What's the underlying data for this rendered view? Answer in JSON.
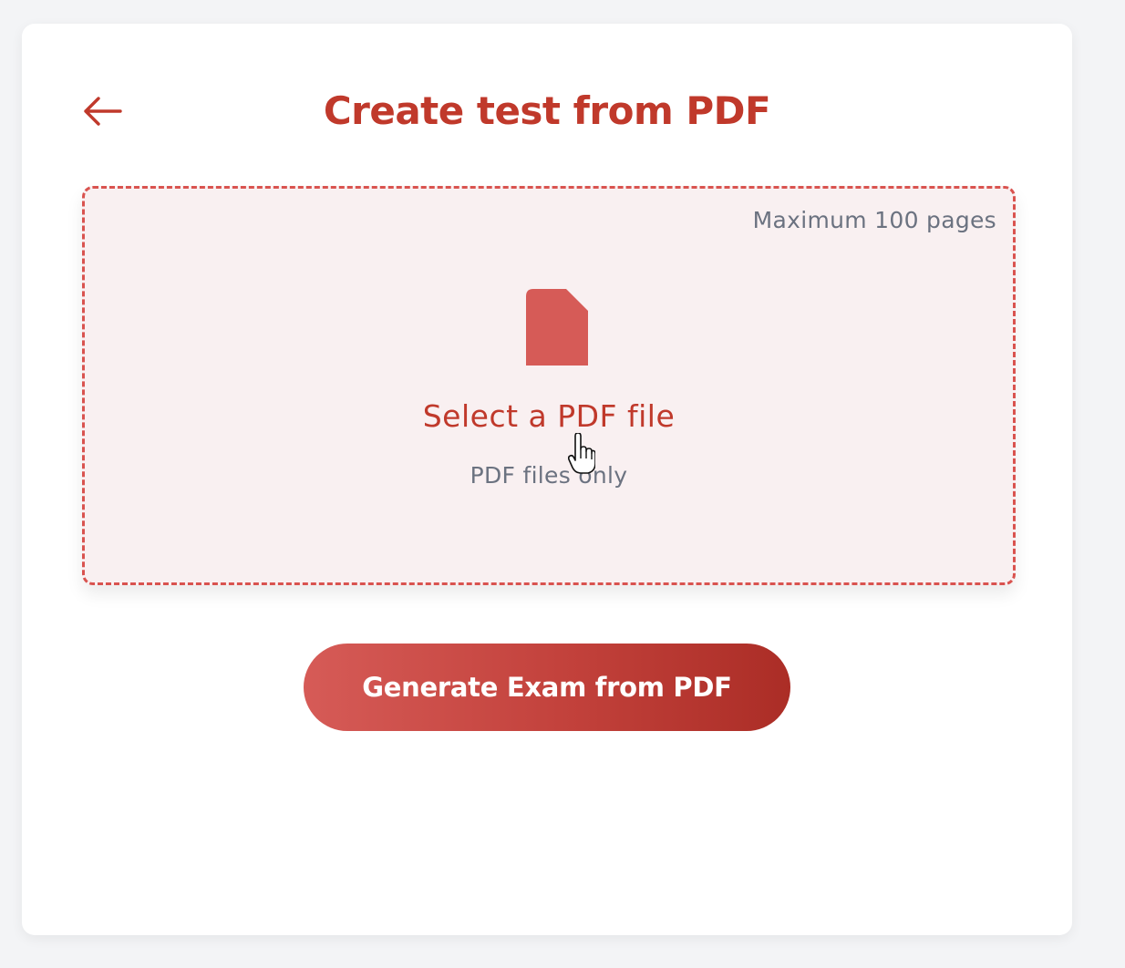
{
  "header": {
    "back_icon": "arrow-left-icon",
    "title": "Create test from PDF"
  },
  "dropzone": {
    "limit_text": "Maximum 100 pages",
    "file_icon": "file-icon",
    "select_label": "Select a PDF file",
    "hint": "PDF files only"
  },
  "actions": {
    "generate_label": "Generate Exam from PDF"
  },
  "colors": {
    "accent": "#c0392b",
    "dropzone_border": "#d9534f",
    "dropzone_bg": "#f9f0f1",
    "muted_text": "#6b7280",
    "button_gradient_start": "#d65b57",
    "button_gradient_end": "#ab2d26"
  }
}
